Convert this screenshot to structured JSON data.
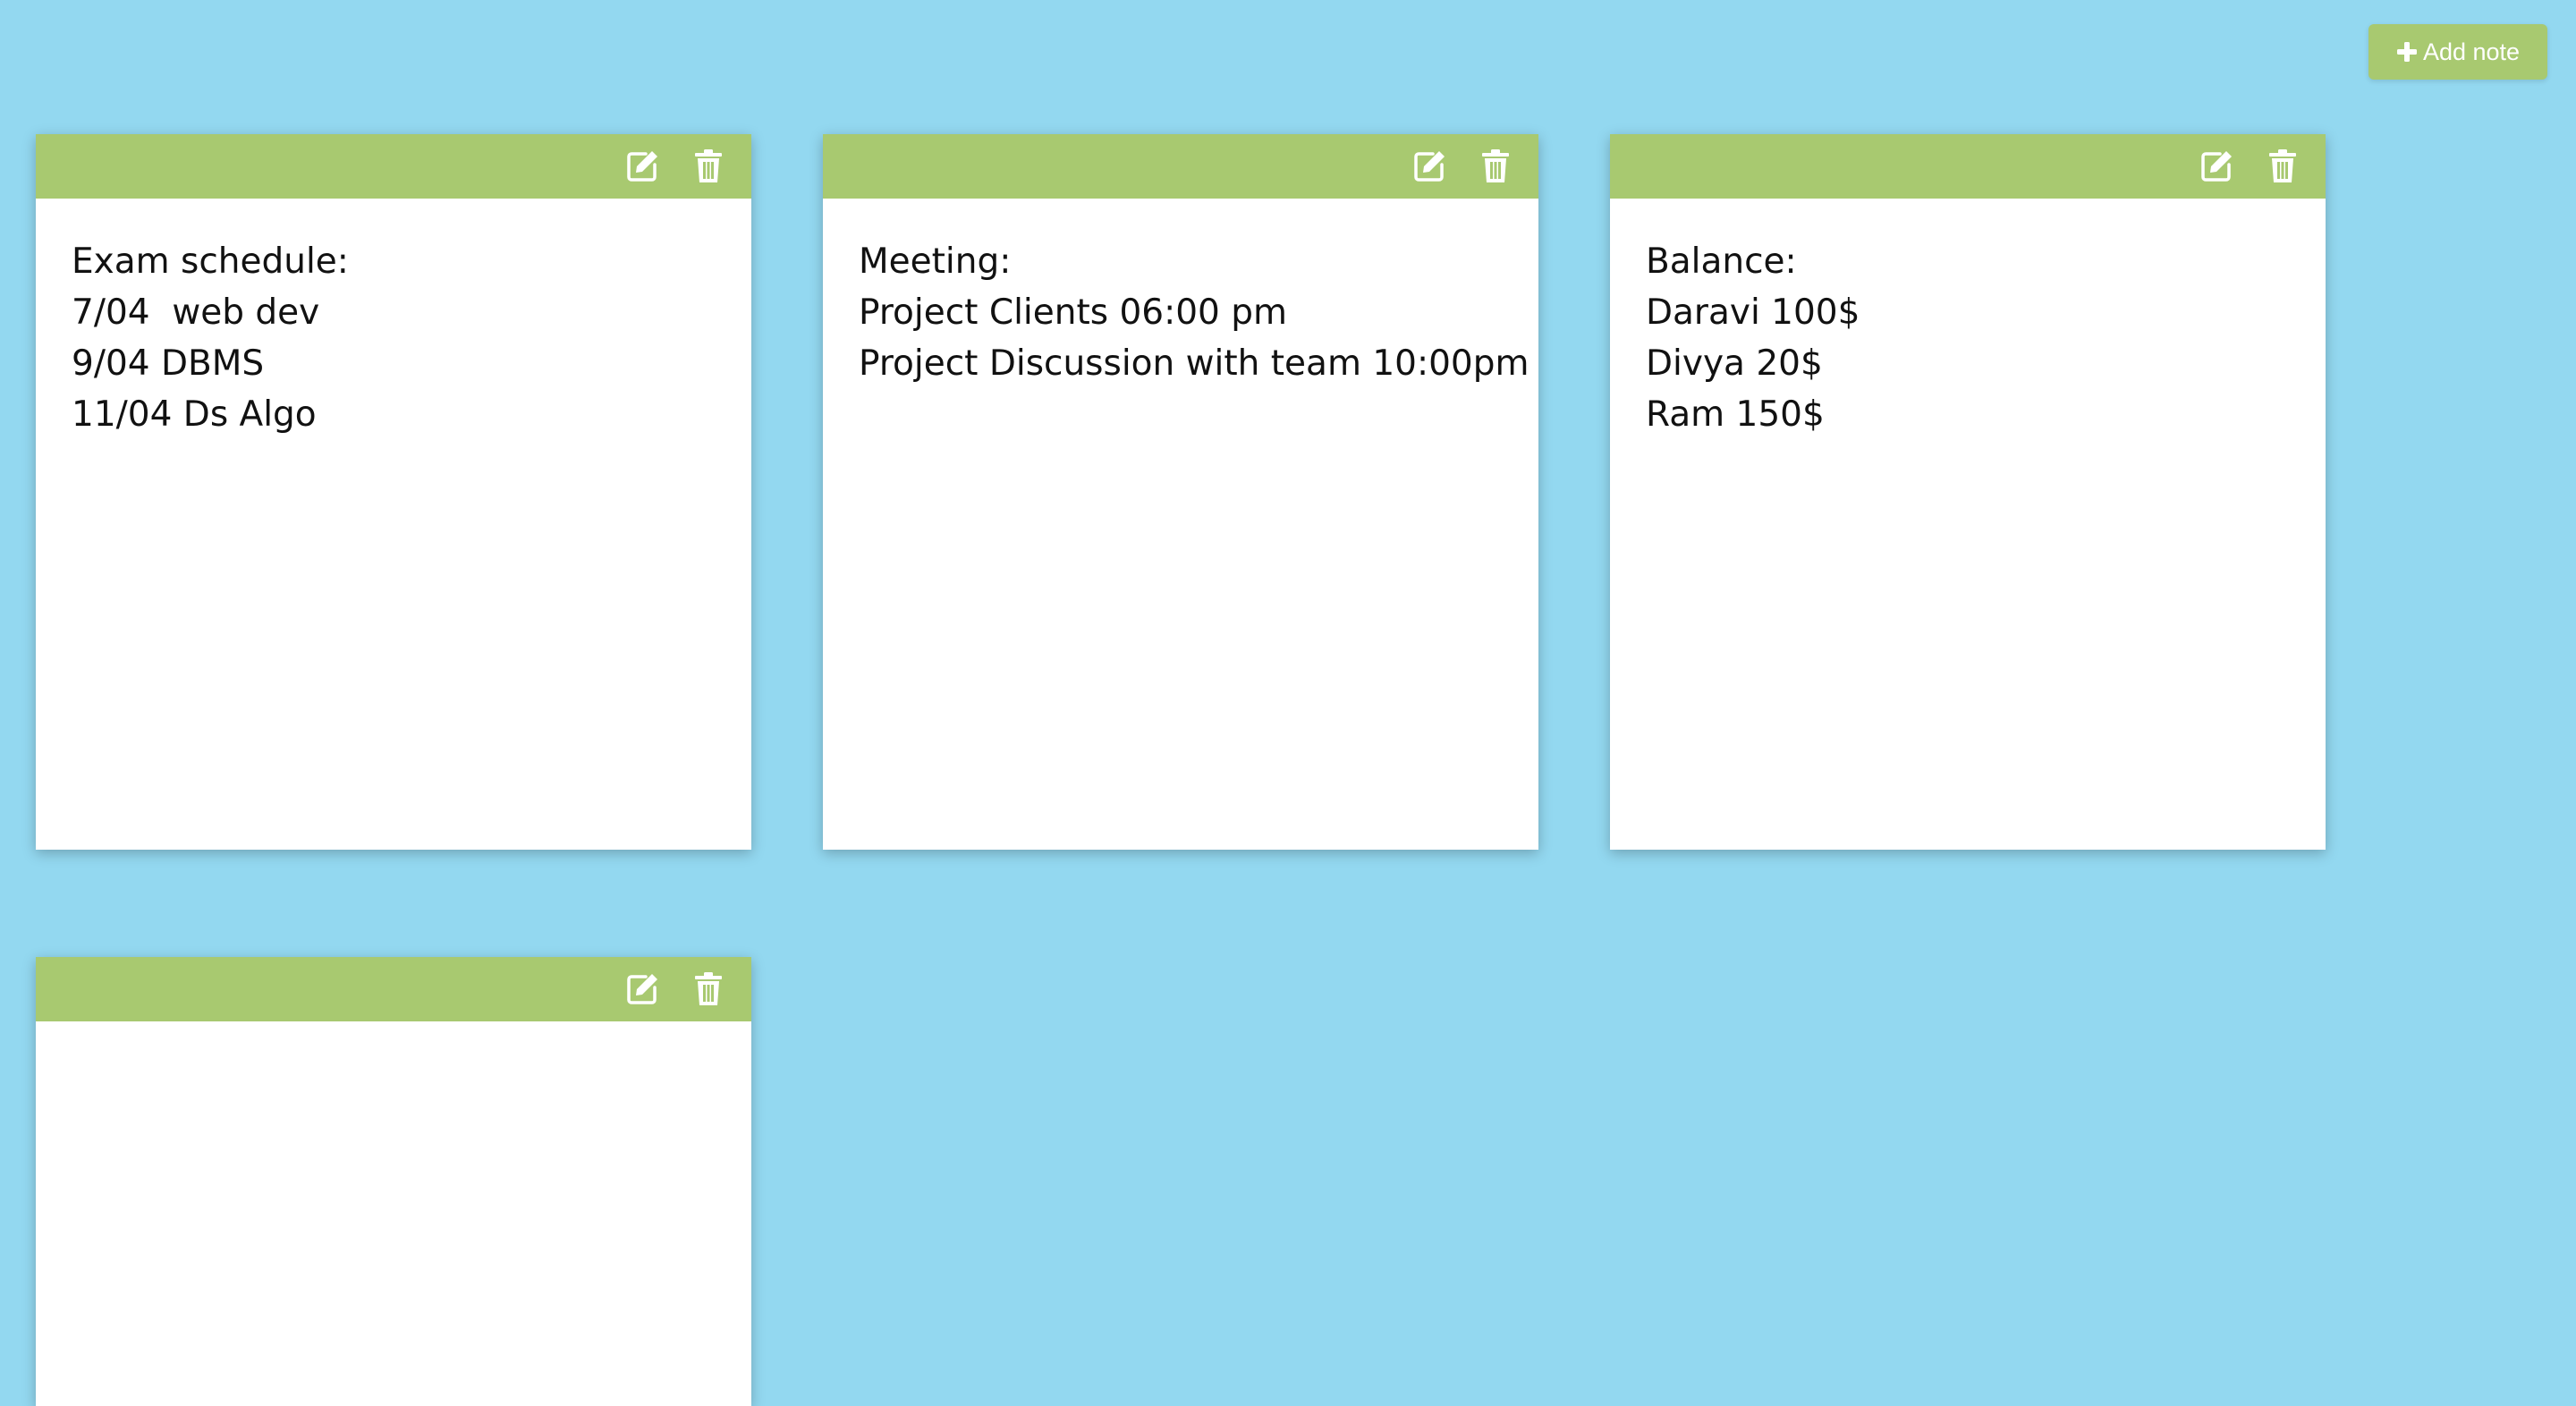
{
  "toolbar": {
    "add_note_label": "Add note"
  },
  "icons": {
    "add": "plus-icon",
    "edit": "edit-icon",
    "delete": "trash-icon"
  },
  "colors": {
    "background": "#93d8f0",
    "accent": "#a8c970",
    "note_body": "#ffffff"
  },
  "notes": [
    {
      "lines": [
        "Exam schedule:",
        "7/04  web dev",
        "9/04 DBMS",
        "11/04 Ds Algo"
      ]
    },
    {
      "lines": [
        "Meeting:",
        "Project Clients 06:00 pm",
        "Project Discussion with team 10:00pm"
      ]
    },
    {
      "lines": [
        "Balance:",
        "Daravi 100$",
        "Divya 20$",
        "Ram 150$"
      ]
    },
    {
      "lines": []
    }
  ]
}
